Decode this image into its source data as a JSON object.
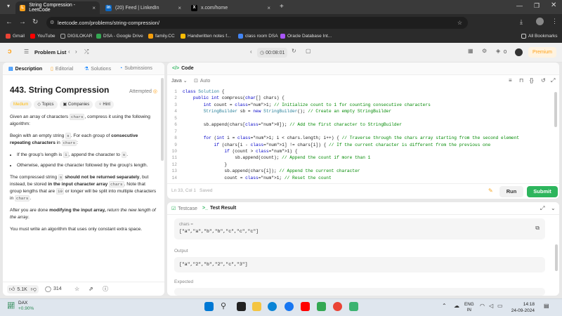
{
  "browser": {
    "tabs": [
      {
        "title": "String Compression - LeetCode",
        "active": true
      },
      {
        "title": "(20) Feed | LinkedIn",
        "active": false
      },
      {
        "title": "x.com/home",
        "active": false
      }
    ],
    "url": "leetcode.com/problems/string-compression/",
    "bookmarks": [
      "Gmail",
      "YouTube",
      "DIGILOKAR",
      "DSA - Google Drive",
      "family.CC",
      "Handwritten notes f...",
      "class room DSA",
      "Oracle Database Int..."
    ],
    "all_bookmarks": "All Bookmarks"
  },
  "header": {
    "problem_list": "Problem List",
    "timer": "00:08:01",
    "notif_count": "0",
    "premium": "Premium"
  },
  "left": {
    "tabs": [
      "Description",
      "Editorial",
      "Solutions",
      "Submissions"
    ],
    "title": "443. String Compression",
    "status": "Attempted",
    "pills": [
      "Medium",
      "Topics",
      "Companies",
      "Hint"
    ],
    "p1a": "Given an array of characters ",
    "p1code": "chars",
    "p1b": ", compress it using the following algorithm:",
    "p2a": "Begin with an empty string ",
    "p2code": "s",
    "p2b": ". For each group of ",
    "p2bold": "consecutive repeating characters",
    "p2c": " in ",
    "p2code2": "chars",
    "p2d": ":",
    "li1a": "If the group's length is ",
    "li1code": "1",
    "li1b": ", append the character to ",
    "li1code2": "s",
    "li1c": ".",
    "li2": "Otherwise, append the character followed by the group's length.",
    "p3a": "The compressed string ",
    "p3code": "s",
    "p3bold": " should not be returned separately",
    "p3b": ", but instead, be stored ",
    "p3bold2": "in the input character array ",
    "p3code2": "chars",
    "p3c": ". Note that group lengths that are ",
    "p3code3": "10",
    "p3d": " or longer will be split into multiple characters in ",
    "p3code4": "chars",
    "p3e": ".",
    "p4a": "After you are done ",
    "p4bold": "modifying the input array,",
    "p4italic": " return the new length of the array",
    "p4b": ".",
    "p5": "You must write an algorithm that uses only constant extra space.",
    "likes": "5.1K",
    "comments": "314"
  },
  "code": {
    "tab": "Code",
    "language": "Java",
    "autosave": "Auto",
    "cursor": "Ln 33, Col 1",
    "saved": "Saved",
    "run": "Run",
    "submit": "Submit",
    "lines": [
      "class Solution {",
      "    public int compress(char[] chars) {",
      "        int count = 1; // Initialize count to 1 for counting consecutive characters",
      "        StringBuilder sb = new StringBuilder(); // Create an empty StringBuilder",
      "",
      "        sb.append(chars[0]); // Add the first character to StringBuilder",
      "",
      "        for (int i = 1; i < chars.length; i++) { // Traverse through the chars array starting from the second element",
      "            if (chars[i - 1] != chars[i]) { // If the current character is different from the previous one",
      "                if (count > 1) {",
      "                    sb.append(count); // Append the count if more than 1",
      "                }",
      "                sb.append(chars[i]); // Append the current character",
      "                count = 1; // Reset the count"
    ]
  },
  "testcase": {
    "tab1": "Testcase",
    "tab2": "Test Result",
    "input_label": "chars =",
    "input": "[\"a\",\"a\",\"b\",\"b\",\"c\",\"c\",\"c\"]",
    "output_label": "Output",
    "output": "[\"a\",\"2\",\"b\",\"2\",\"c\",\"3\"]",
    "expected_label": "Expected"
  },
  "taskbar": {
    "ticker": "DAX",
    "ticker_change": "+0.90%",
    "lang1": "ENG",
    "lang2": "IN",
    "time": "14:18",
    "date": "24-09-2024"
  },
  "colors": {
    "accent_green": "#2db55d",
    "medium": "#ffb800",
    "premium": "#ffa116"
  }
}
